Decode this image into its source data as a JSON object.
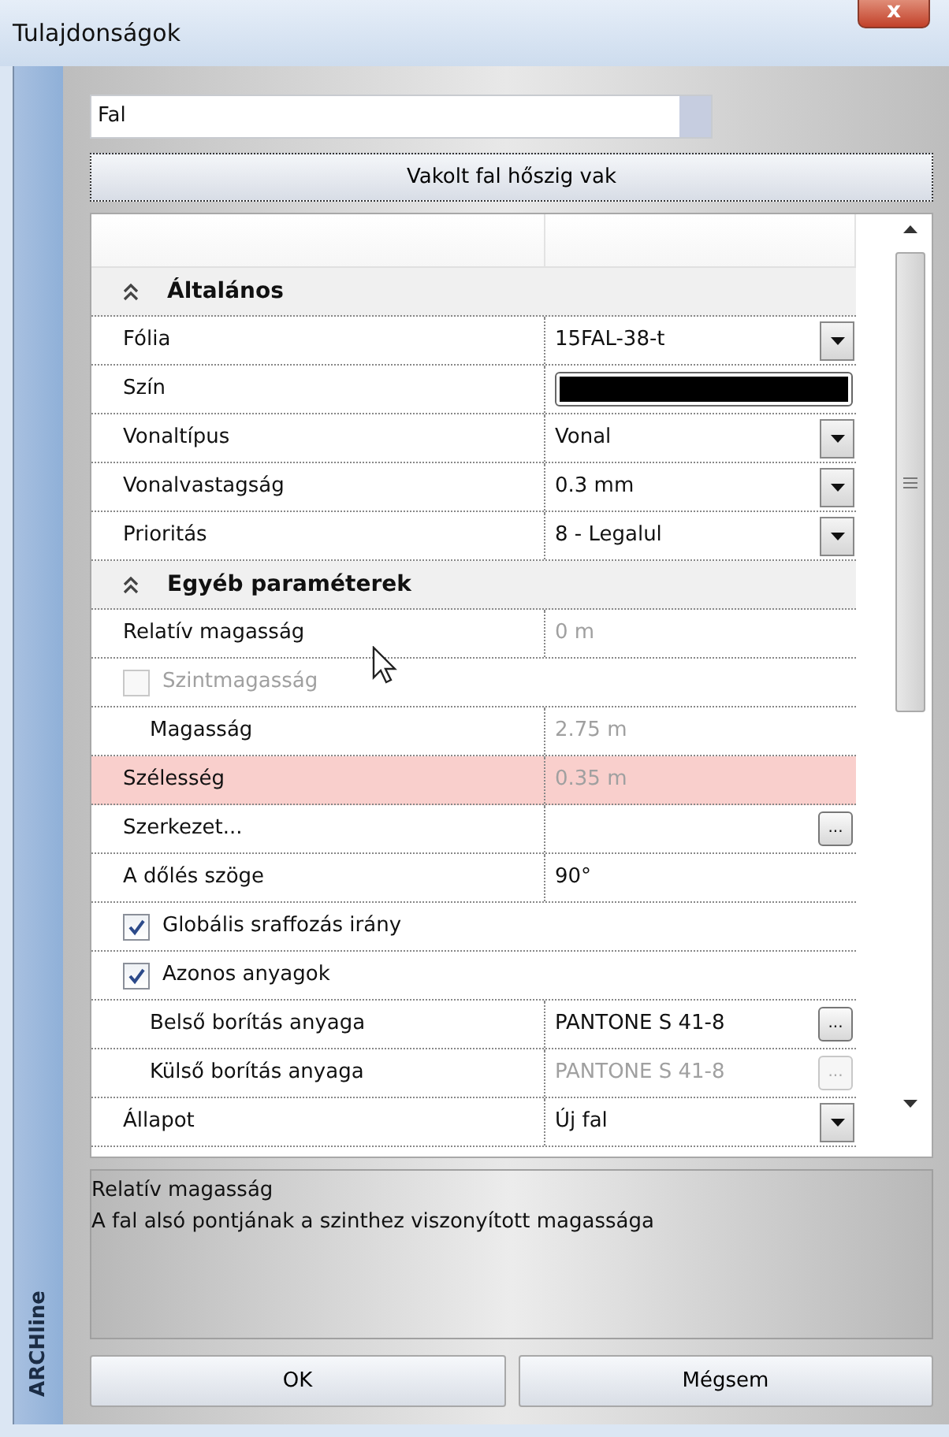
{
  "window": {
    "title": "Tulajdonságok",
    "close": "x"
  },
  "sidebar": {
    "label": "ARCHline"
  },
  "type_combo": {
    "value": "Fal"
  },
  "style_button": {
    "label": "Vakolt fal hőszig vak"
  },
  "properties": [
    {
      "kind": "section",
      "label": "Általános",
      "expanded": true
    },
    {
      "kind": "dropdown",
      "label": "Fólia",
      "value": "15FAL-38-t"
    },
    {
      "kind": "color",
      "label": "Szín",
      "color": "#000000"
    },
    {
      "kind": "dropdown",
      "label": "Vonaltípus",
      "value": "Vonal"
    },
    {
      "kind": "dropdown",
      "label": "Vonalvastagság",
      "value": "0.3 mm"
    },
    {
      "kind": "dropdown",
      "label": "Prioritás",
      "value": "8 - Legalul"
    },
    {
      "kind": "section",
      "label": "Egyéb paraméterek",
      "expanded": true
    },
    {
      "kind": "text",
      "label": "Relatív magasság",
      "value": "0 m",
      "disabled": true,
      "highlighted": false
    },
    {
      "kind": "checkbox",
      "label": "Szintmagasság",
      "checked": false,
      "disabled": true,
      "children": [
        {
          "kind": "text",
          "label": "Magasság",
          "value": "2.75 m",
          "disabled": true,
          "highlighted": false
        }
      ]
    },
    {
      "kind": "text",
      "label": "Szélesség",
      "value": "0.35 m",
      "disabled": true,
      "highlighted": true
    },
    {
      "kind": "button",
      "label": "Szerkezet...",
      "button": "...",
      "disabled": false
    },
    {
      "kind": "text",
      "label": "A dőlés szöge",
      "value": "90°",
      "disabled": false,
      "highlighted": false
    },
    {
      "kind": "checkbox",
      "label": "Globális sraffozás irány",
      "checked": true,
      "disabled": false
    },
    {
      "kind": "checkbox",
      "label": "Azonos anyagok",
      "checked": true,
      "disabled": false,
      "children": [
        {
          "kind": "button",
          "label": "Belső borítás anyaga",
          "value": "PANTONE S 41-8",
          "button": "...",
          "disabled": false
        },
        {
          "kind": "button",
          "label": "Külső borítás anyaga",
          "value": "PANTONE S 41-8",
          "button": "...",
          "disabled": true
        }
      ]
    },
    {
      "kind": "dropdown",
      "label": "Állapot",
      "value": "Új fal"
    }
  ],
  "description": {
    "title": "Relatív magasság",
    "text": "A fal alsó pontjának a szinthez viszonyított magassága"
  },
  "buttons": [
    "OK",
    "Mégsem"
  ]
}
